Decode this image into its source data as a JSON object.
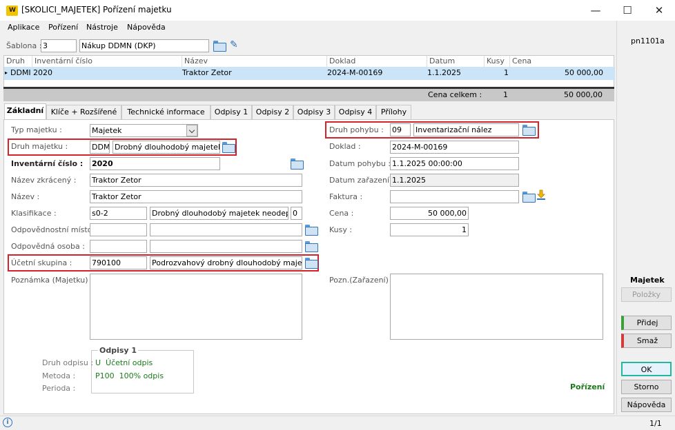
{
  "window": {
    "logo": "W",
    "title": "[SKOLICI_MAJETEK] Pořízení majetku",
    "minimize": "—",
    "maximize": "☐",
    "close": "✕"
  },
  "menu": [
    "Aplikace",
    "Pořízení",
    "Nástroje",
    "Nápověda"
  ],
  "sablona": {
    "label": "Šablona :",
    "code": "3",
    "name": "Nákup DDMN (DKP)"
  },
  "grid": {
    "columns": [
      "Druh",
      "Inventární číslo",
      "Název",
      "Doklad",
      "Datum",
      "Kusy",
      "Cena"
    ],
    "row": {
      "marker": "▸",
      "druh": "DDMI",
      "inv": "2020",
      "nazev": "Traktor Zetor",
      "doklad": "2024-M-00169",
      "datum": "1.1.2025",
      "kusy": "1",
      "cena": "50 000,00"
    },
    "total_label": "Cena celkem :",
    "total_kusy": "1",
    "total_cena": "50 000,00"
  },
  "tabs": [
    "Základní",
    "Klíče + Rozšířené",
    "Technické informace",
    "Odpisy 1",
    "Odpisy 2",
    "Odpisy 3",
    "Odpisy 4",
    "Přílohy"
  ],
  "left": {
    "typ_label": "Typ majetku :",
    "typ_value": "Majetek",
    "druh_label": "Druh majetku :",
    "druh_code": "DDM",
    "druh_name": "Drobný dlouhodobý majetek",
    "inv_label": "Inventární číslo :",
    "inv_value": "2020",
    "nazev_zkr_label": "Název zkrácený :",
    "nazev_zkr_value": "Traktor Zetor",
    "nazev_label": "Název :",
    "nazev_value": "Traktor Zetor",
    "klas_label": "Klasifikace :",
    "klas_code": "s0-2",
    "klas_name": "Drobný dlouhodobý majetek neodep",
    "klas_num": "0",
    "odp_misto_label": "Odpovědnostní místo :",
    "odp_osoba_label": "Odpovědná osoba :",
    "ucetni_label": "Účetní skupina :",
    "ucetni_code": "790100",
    "ucetni_name": "Podrozvahový drobný dlouhodobý maje",
    "poznamka_label": "Poznámka (Majetku) :"
  },
  "right": {
    "pohyb_label": "Druh pohybu :",
    "pohyb_code": "09",
    "pohyb_name": "Inventarizační nález",
    "doklad_label": "Doklad :",
    "doklad_value": "2024-M-00169",
    "datum_pohybu_label": "Datum pohybu :",
    "datum_pohybu_value": "1.1.2025 00:00:00",
    "datum_zar_label": "Datum zařazení :",
    "datum_zar_value": "1.1.2025",
    "faktura_label": "Faktura :",
    "cena_label": "Cena :",
    "cena_value": "50 000,00",
    "kusy_label": "Kusy :",
    "kusy_value": "1",
    "pozn_label": "Pozn.(Zařazení) :"
  },
  "odpisy": {
    "title": "Odpisy 1",
    "druh_label": "Druh odpisu :",
    "druh_value": "U  Účetní odpis",
    "metoda_label": "Metoda :",
    "metoda_value": "P100  100% odpis",
    "perioda_label": "Perioda :"
  },
  "porizeni": "Pořízení",
  "sidebar": {
    "id": "pn1101a",
    "section": "Majetek",
    "polozky": "Položky",
    "pridej": "Přidej",
    "smaz": "Smaž",
    "ok": "OK",
    "storno": "Storno",
    "napoveda": "Nápověda"
  },
  "status": {
    "info": "i",
    "page": "1/1"
  }
}
